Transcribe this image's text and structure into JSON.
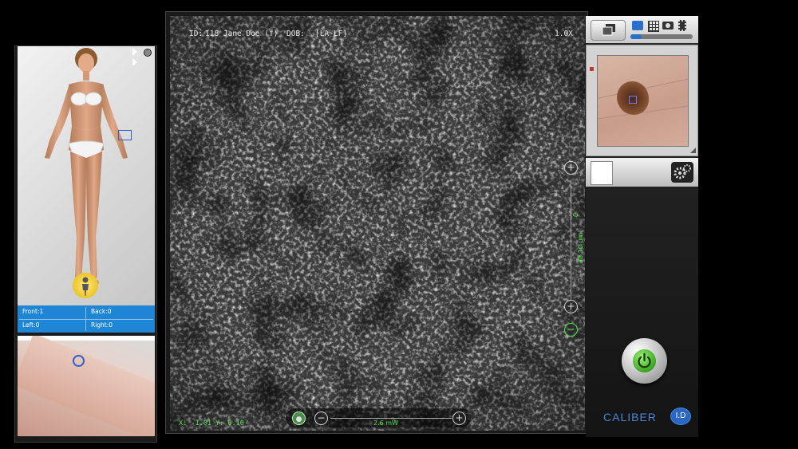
{
  "viewer": {
    "info": {
      "id_label": "ID:",
      "patient": "118 Jane Doe (f)",
      "dob_label": "DOB:",
      "site": "[LA-LF]",
      "zoom": "1.0X"
    },
    "coords": "X: -1.01 Y: 0.10",
    "power": "2.6 mW",
    "depth": "38.10 µm",
    "depth_zero": "0"
  },
  "body_map": {
    "stats": {
      "front": "Front:1",
      "back": "Back:0",
      "left": "Left:0",
      "right": "Right:0"
    }
  },
  "logo": {
    "brand": "CALIBER",
    "suffix": "I.D"
  },
  "colors": {
    "accent_blue": "#1f86d6",
    "overlay_green": "#4fe24f",
    "marker_blue": "#2b5fd4"
  },
  "icons": [
    "layers-icon",
    "stack-icon",
    "grid-icon",
    "camera-icon",
    "film-icon",
    "gear-icon",
    "power-icon",
    "plus-icon",
    "minus-icon",
    "person-icon"
  ]
}
